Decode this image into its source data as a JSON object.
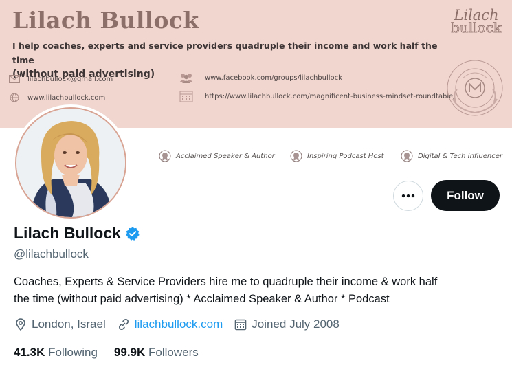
{
  "banner": {
    "title": "Lilach Bullock",
    "tagline_line1": "I help coaches, experts and service providers quadruple their income and work half the time",
    "tagline_line2": "(without paid advertising)",
    "email": "lilachbullock@gmail.com",
    "website": "www.lilachbullock.com",
    "facebook": "www.facebook.com/groups/lilachbullock",
    "roundtable": "https://www.lilachbullock.com/magnificent-business-mindset-roundtable/",
    "logo_script": "Lilach",
    "logo_sub": "bullock",
    "seal_text": "Magnificent Business Mindset"
  },
  "badges": [
    {
      "label": "Acclaimed Speaker & Author",
      "icon": "award-icon"
    },
    {
      "label": "Inspiring Podcast Host",
      "icon": "award-icon"
    },
    {
      "label": "Digital & Tech Influencer",
      "icon": "award-icon"
    }
  ],
  "actions": {
    "more_icon": "more-icon",
    "follow_label": "Follow"
  },
  "profile": {
    "name": "Lilach Bullock",
    "handle": "@lilachbullock",
    "bio_line1": "Coaches, Experts & Service Providers hire me to quadruple their income & work half",
    "bio_line2": "the time (without paid advertising) * Acclaimed Speaker & Author * Podcast",
    "location": "London, Israel",
    "website": "lilachbullock.com",
    "joined": "Joined July 2008"
  },
  "stats": {
    "following_count": "41.3K",
    "following_label": "Following",
    "followers_count": "99.9K",
    "followers_label": "Followers"
  },
  "colors": {
    "banner": "#f1d6cf",
    "accent": "#1d9bf0",
    "follow_button": "#0f1419",
    "verified": "#1d9bf0"
  }
}
